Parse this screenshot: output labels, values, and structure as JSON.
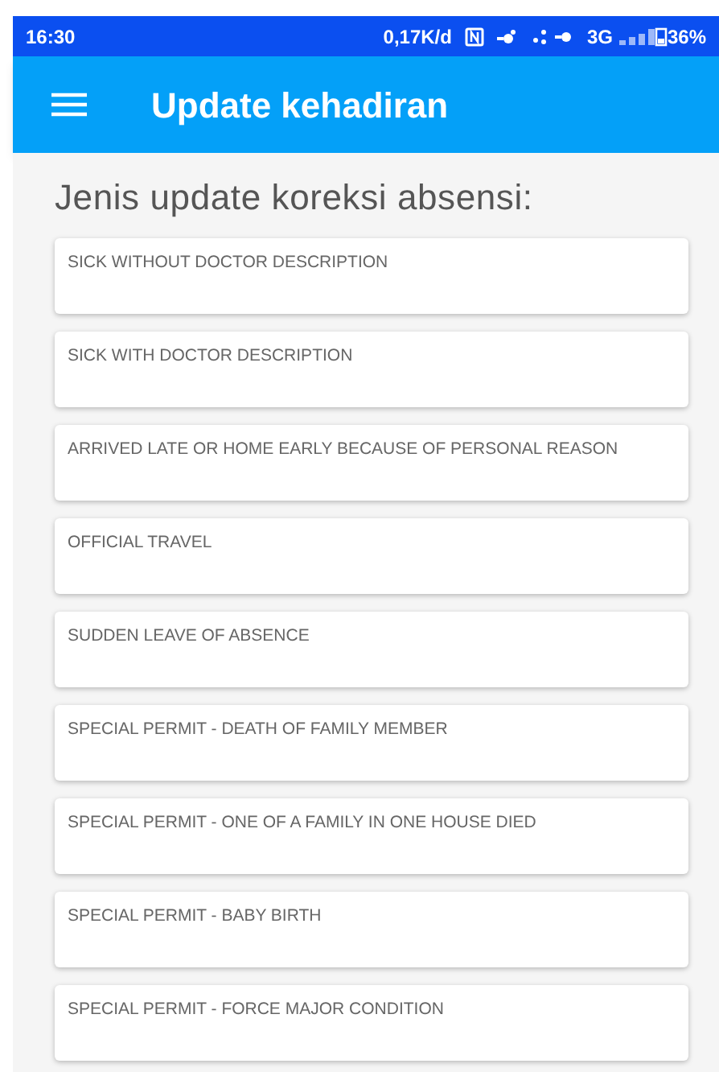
{
  "status_bar": {
    "time": "16:30",
    "speed": "0,17K/d",
    "network": "3G",
    "battery": "36%"
  },
  "app_bar": {
    "title": "Update kehadiran"
  },
  "heading": "Jenis update koreksi absensi:",
  "options": [
    {
      "label": "SICK WITHOUT DOCTOR DESCRIPTION"
    },
    {
      "label": "SICK WITH DOCTOR DESCRIPTION"
    },
    {
      "label": "ARRIVED LATE OR HOME EARLY BECAUSE OF PERSONAL REASON"
    },
    {
      "label": "OFFICIAL TRAVEL"
    },
    {
      "label": "SUDDEN LEAVE OF ABSENCE"
    },
    {
      "label": "SPECIAL PERMIT - DEATH OF FAMILY MEMBER"
    },
    {
      "label": "SPECIAL PERMIT - ONE OF A FAMILY IN ONE HOUSE DIED"
    },
    {
      "label": "SPECIAL PERMIT - BABY BIRTH"
    },
    {
      "label": "SPECIAL PERMIT - FORCE MAJOR CONDITION"
    }
  ]
}
